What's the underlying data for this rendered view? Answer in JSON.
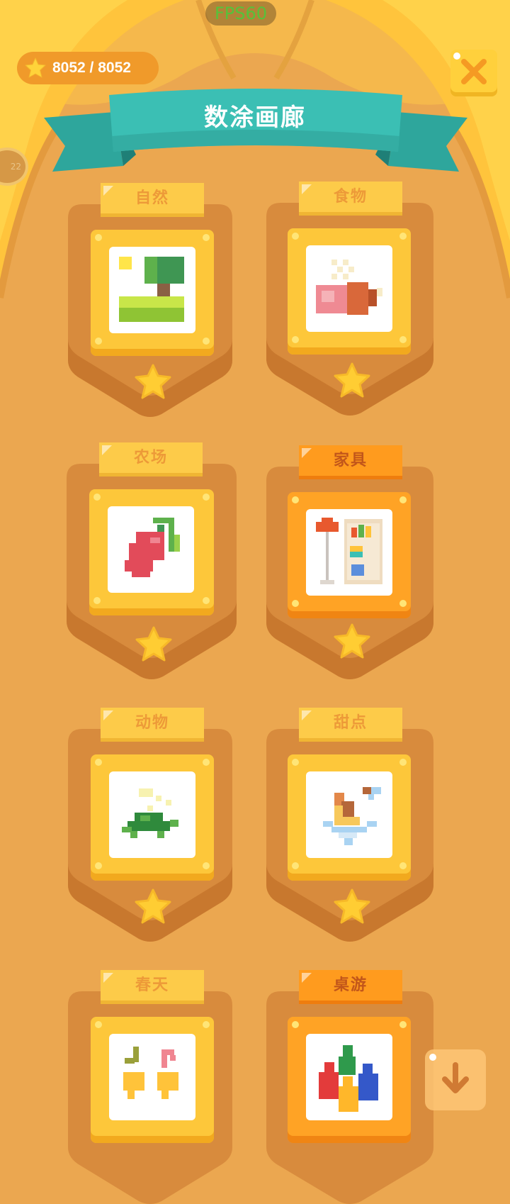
{
  "fps_label": "FPS60",
  "score": {
    "text": "8052 / 8052"
  },
  "side_tab": {
    "text": "22"
  },
  "title": "数涂画廊",
  "categories": [
    {
      "label": "自然",
      "highlighted": false
    },
    {
      "label": "食物",
      "highlighted": false
    },
    {
      "label": "农场",
      "highlighted": false
    },
    {
      "label": "家具",
      "highlighted": true
    },
    {
      "label": "动物",
      "highlighted": false
    },
    {
      "label": "甜点",
      "highlighted": false
    },
    {
      "label": "春天",
      "highlighted": false
    },
    {
      "label": "桌游",
      "highlighted": true
    }
  ],
  "icons": {
    "close": "close-icon",
    "scroll_down": "arrow-down-icon",
    "star": "star-icon"
  },
  "colors": {
    "background": "#eba750",
    "banner": "#3bbfb4",
    "frame": "#fdc73a",
    "highlight": "#ff9b1e",
    "star": "#ffcd33"
  }
}
